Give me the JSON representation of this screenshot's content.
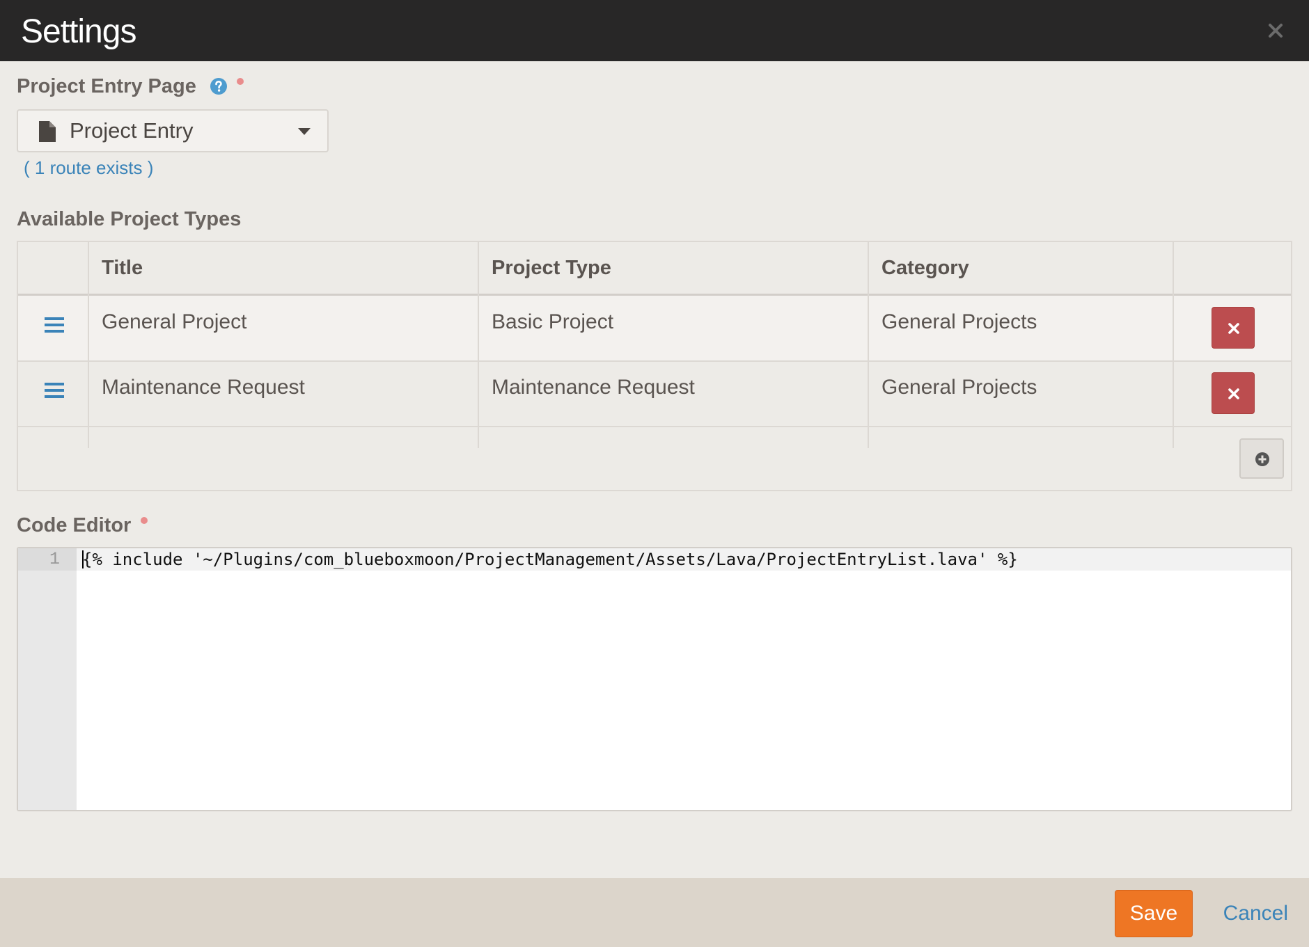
{
  "modal": {
    "title": "Settings",
    "close_icon": "close-icon"
  },
  "entry_page": {
    "label": "Project Entry Page",
    "help_icon": "question-circle-icon",
    "required": true,
    "selected_page": "Project Entry",
    "page_icon": "file-icon",
    "route_info": "( 1 route exists )"
  },
  "project_types": {
    "label": "Available Project Types",
    "columns": [
      "Title",
      "Project Type",
      "Category"
    ],
    "rows": [
      {
        "title": "General Project",
        "project_type": "Basic Project",
        "category": "General Projects"
      },
      {
        "title": "Maintenance Request",
        "project_type": "Maintenance Request",
        "category": "General Projects"
      }
    ],
    "drag_icon": "bars-icon",
    "delete_icon": "times-icon",
    "add_icon": "plus-circle-icon"
  },
  "code_editor": {
    "label": "Code Editor",
    "required": true,
    "lines": [
      {
        "number": "1",
        "text": "{% include '~/Plugins/com_blueboxmoon/ProjectManagement/Assets/Lava/ProjectEntryList.lava' %}"
      }
    ]
  },
  "footer": {
    "save_label": "Save",
    "cancel_label": "Cancel"
  },
  "colors": {
    "header_bg": "#282727",
    "primary": "#ee7624",
    "danger": "#bc4d4f",
    "link": "#3a83b8",
    "page_bg": "#edebe7",
    "footer_bg": "#dcd5cb"
  }
}
